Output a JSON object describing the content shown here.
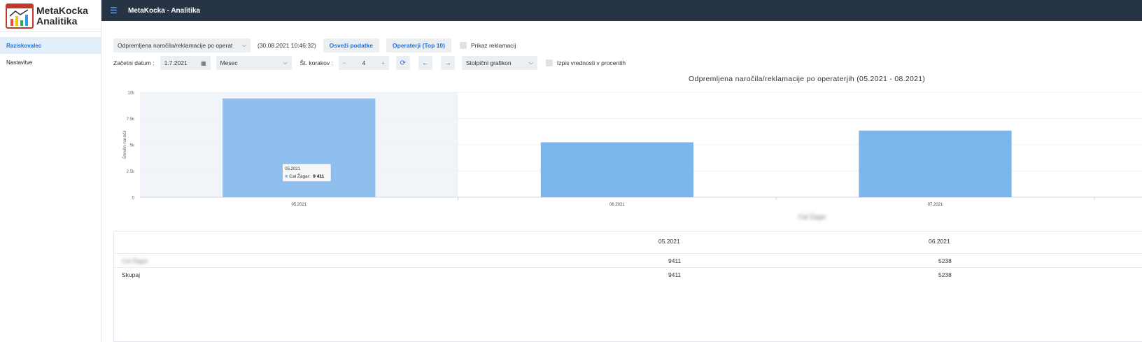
{
  "app": {
    "logo_line1": "MetaKocka",
    "logo_line2": "Analitika",
    "title": "MetaKocka - Analitika"
  },
  "sidebar": {
    "items": [
      {
        "label": "Raziskovalec",
        "active": true
      },
      {
        "label": "Nastavitve",
        "active": false
      }
    ]
  },
  "toolbar": {
    "report_select": "Odpremljena naročila/reklamacije po operat",
    "timestamp": "(30.08.2021 10:46:32)",
    "refresh_label": "Osveži podatke",
    "operators_label": "Operaterji (Top 10)",
    "show_claims_label": "Prikaz reklamacij",
    "start_date_label": "Začetni datum :",
    "start_date_value": "1.7.2021",
    "period_select": "Mesec",
    "steps_label": "Št. korakov :",
    "steps_value": "4",
    "chart_type_select": "Stolpični grafikon",
    "percent_label": "Izpis vrednosti v procentih"
  },
  "chart_data": {
    "type": "bar",
    "title": "Odpremljena naročila/reklamacije po operaterjih (05.2021 - 08.2021)",
    "ylabel": "Število naročil",
    "ylim": [
      0,
      10000
    ],
    "y_ticks": [
      "0",
      "2.5k",
      "5k",
      "7.5k",
      "10k"
    ],
    "categories": [
      "05.2021",
      "06.2021",
      "07.2021"
    ],
    "values": [
      9411,
      5238,
      6350
    ],
    "legend_entry": "Cal Žagar",
    "tooltip": {
      "category": "05.2021",
      "series": "Cal Žagar:",
      "value": "9 411"
    },
    "colors": {
      "bar": "#7cb5ec",
      "highlight": "#f1f4f9"
    }
  },
  "table": {
    "headers": [
      "05.2021",
      "06.2021"
    ],
    "rows": [
      {
        "label": "Cal Žagar",
        "values": [
          "9411",
          "5238"
        ]
      },
      {
        "label": "Skupaj",
        "values": [
          "9411",
          "5238"
        ]
      }
    ]
  }
}
